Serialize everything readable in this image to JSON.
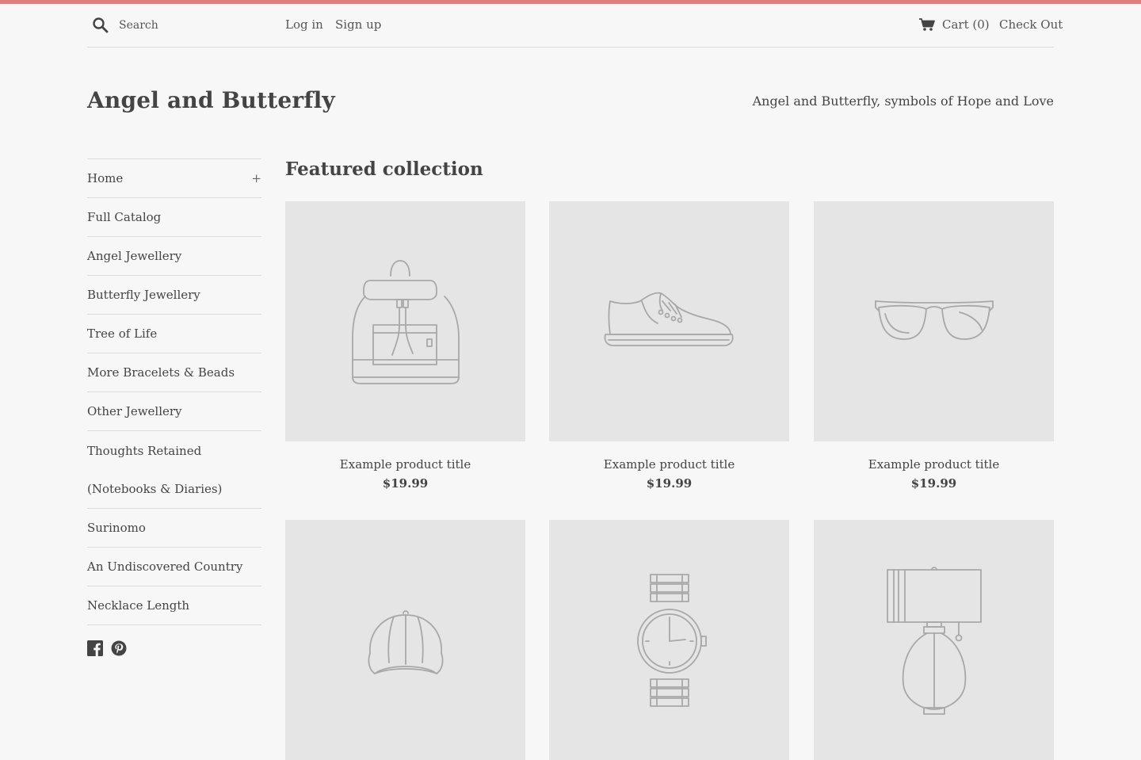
{
  "header": {
    "search_placeholder": "Search",
    "login_label": "Log in",
    "signup_label": "Sign up",
    "cart_label": "Cart (0)",
    "checkout_label": "Check Out"
  },
  "store": {
    "name": "Angel and Butterfly",
    "tagline": "Angel and Butterfly, symbols of Hope and Love"
  },
  "sidebar": {
    "items": [
      {
        "label": "Home",
        "expand": "+"
      },
      {
        "label": "Full Catalog"
      },
      {
        "label": "Angel Jewellery"
      },
      {
        "label": "Butterfly Jewellery"
      },
      {
        "label": "Tree of Life"
      },
      {
        "label": "More Bracelets & Beads"
      },
      {
        "label": "Other Jewellery"
      },
      {
        "label": "Thoughts Retained (Notebooks & Diaries)"
      },
      {
        "label": "Surinomo"
      },
      {
        "label": "An Undiscovered Country"
      },
      {
        "label": "Necklace Length"
      }
    ],
    "social": [
      "facebook-icon",
      "pinterest-icon"
    ]
  },
  "collection": {
    "title": "Featured collection",
    "products": [
      {
        "title": "Example product title",
        "price": "$19.99",
        "icon": "backpack-icon"
      },
      {
        "title": "Example product title",
        "price": "$19.99",
        "icon": "shoe-icon"
      },
      {
        "title": "Example product title",
        "price": "$19.99",
        "icon": "sunglasses-icon"
      },
      {
        "icon": "cap-icon"
      },
      {
        "icon": "watch-icon"
      },
      {
        "icon": "lamp-icon"
      }
    ]
  },
  "colors": {
    "accent": "#e07d7d",
    "background": "#f7f7f7",
    "placeholder": "#e5e5e5",
    "text": "#444444"
  }
}
